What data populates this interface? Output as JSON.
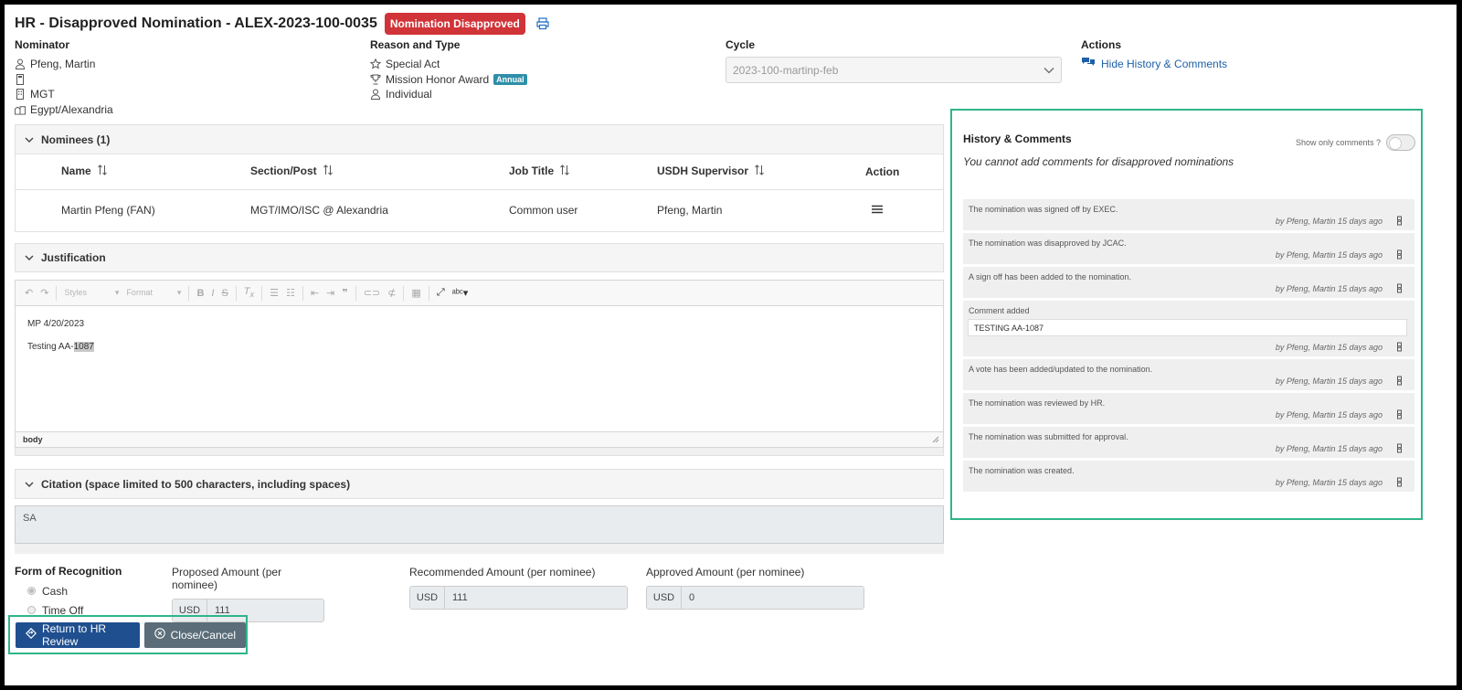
{
  "header": {
    "title": "HR - Disapproved Nomination - ALEX-2023-100-0035",
    "status": "Nomination Disapproved"
  },
  "nominator": {
    "label": "Nominator",
    "name": "Pfeng, Martin",
    "unit": "MGT",
    "location": "Egypt/Alexandria"
  },
  "reason": {
    "label": "Reason and Type",
    "reason": "Special Act",
    "award": "Mission Honor Award",
    "award_badge": "Annual",
    "type": "Individual"
  },
  "cycle": {
    "label": "Cycle",
    "value": "2023-100-martinp-feb"
  },
  "actions": {
    "label": "Actions",
    "toggle_history": "Hide History & Comments"
  },
  "nominees": {
    "header": "Nominees (1)",
    "columns": [
      "Name",
      "Section/Post",
      "Job Title",
      "USDH Supervisor",
      "Action"
    ],
    "rows": [
      {
        "name": "Martin Pfeng (FAN)",
        "section": "MGT/IMO/ISC @ Alexandria",
        "job_title": "Common user",
        "supervisor": "Pfeng, Martin"
      }
    ]
  },
  "justification": {
    "header": "Justification",
    "toolbar": {
      "styles": "Styles",
      "format": "Format"
    },
    "lines": [
      "MP 4/20/2023",
      "Testing AA-",
      "1087"
    ],
    "footer": "body"
  },
  "citation": {
    "header": "Citation (space limited to 500 characters, including spaces)",
    "value": "SA"
  },
  "recognition": {
    "label": "Form of Recognition",
    "options": [
      "Cash",
      "Time Off"
    ],
    "selected": "Cash"
  },
  "amounts": {
    "proposed": {
      "label": "Proposed Amount (per nominee)",
      "currency": "USD",
      "value": "111"
    },
    "recommended": {
      "label": "Recommended Amount (per nominee)",
      "currency": "USD",
      "value": "111"
    },
    "approved": {
      "label": "Approved Amount (per nominee)",
      "currency": "USD",
      "value": "0"
    }
  },
  "buttons": {
    "return": "Return to HR Review",
    "close": "Close/Cancel"
  },
  "history": {
    "title": "History & Comments",
    "toggle_label": "Show only comments ?",
    "notice": "You cannot add comments for disapproved nominations",
    "items": [
      {
        "text": "The nomination was signed off by EXEC.",
        "meta": "by Pfeng, Martin 15 days ago"
      },
      {
        "text": "The nomination was disapproved by JCAC.",
        "meta": "by Pfeng, Martin 15 days ago"
      },
      {
        "text": "A sign off has been added to the nomination.",
        "meta": "by Pfeng, Martin 15 days ago"
      },
      {
        "text": "Comment added",
        "comment": "TESTING AA-1087",
        "meta": "by Pfeng, Martin 15 days ago"
      },
      {
        "text": "A vote has been added/updated to the nomination.",
        "meta": "by Pfeng, Martin 15 days ago"
      },
      {
        "text": "The nomination was reviewed by HR.",
        "meta": "by Pfeng, Martin 15 days ago"
      },
      {
        "text": "The nomination was submitted for approval.",
        "meta": "by Pfeng, Martin 15 days ago"
      },
      {
        "text": "The nomination was created.",
        "meta": "by Pfeng, Martin 15 days ago"
      }
    ]
  }
}
